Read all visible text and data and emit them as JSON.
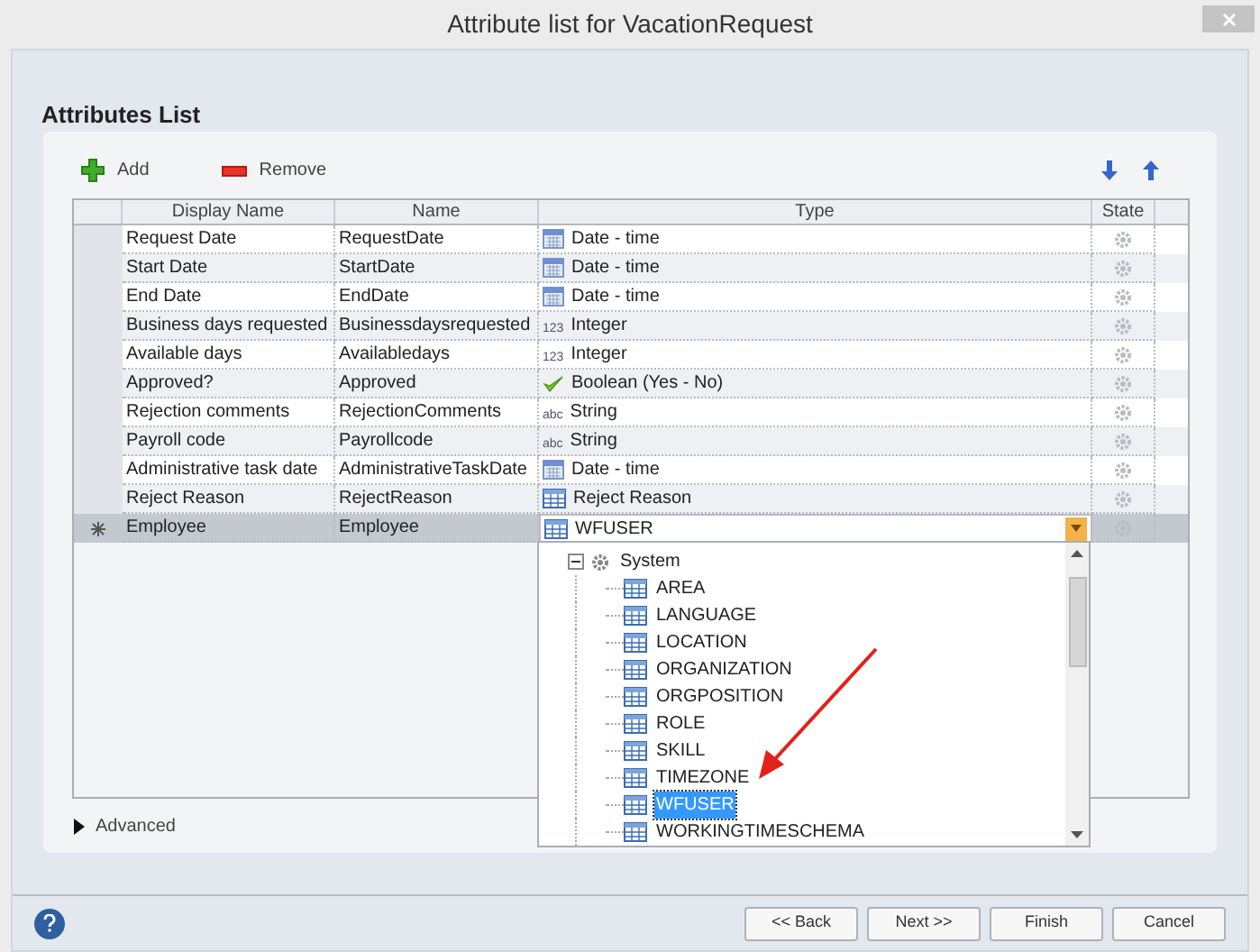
{
  "window": {
    "title": "Attribute list for VacationRequest"
  },
  "heading": "Attributes List",
  "toolbar": {
    "add": "Add",
    "remove": "Remove"
  },
  "table": {
    "columns": [
      "Display Name",
      "Name",
      "Type",
      "State"
    ],
    "rows": [
      {
        "display_name": "Request Date",
        "name": "RequestDate",
        "type": "Date - time",
        "kind": "datetime",
        "selected": false
      },
      {
        "display_name": "Start Date",
        "name": "StartDate",
        "type": "Date - time",
        "kind": "datetime",
        "selected": false
      },
      {
        "display_name": "End Date",
        "name": "EndDate",
        "type": "Date - time",
        "kind": "datetime",
        "selected": false
      },
      {
        "display_name": "Business days requested",
        "name": "Businessdaysrequested",
        "type": "Integer",
        "kind": "integer",
        "icon_text": "123",
        "selected": false
      },
      {
        "display_name": "Available days",
        "name": "Availabledays",
        "type": "Integer",
        "kind": "integer",
        "icon_text": "123",
        "selected": false
      },
      {
        "display_name": "Approved?",
        "name": "Approved",
        "type": "Boolean (Yes - No)",
        "kind": "boolean",
        "selected": false
      },
      {
        "display_name": "Rejection comments",
        "name": "RejectionComments",
        "type": "String",
        "kind": "string",
        "icon_text": "abc",
        "selected": false
      },
      {
        "display_name": "Payroll code",
        "name": "Payrollcode",
        "type": "String",
        "kind": "string",
        "icon_text": "abc",
        "selected": false
      },
      {
        "display_name": "Administrative task date",
        "name": "AdministrativeTaskDate",
        "type": "Date - time",
        "kind": "datetime",
        "selected": false
      },
      {
        "display_name": "Reject Reason",
        "name": "RejectReason",
        "type": "Reject Reason",
        "kind": "entity",
        "selected": false
      },
      {
        "display_name": "Employee",
        "name": "Employee",
        "type": "WFUSER",
        "kind": "entity",
        "selected": true
      }
    ]
  },
  "dropdown": {
    "group": {
      "label": "System",
      "expanded": true,
      "children": [
        {
          "label": "AREA",
          "selected": false
        },
        {
          "label": "LANGUAGE",
          "selected": false
        },
        {
          "label": "LOCATION",
          "selected": false
        },
        {
          "label": "ORGANIZATION",
          "selected": false
        },
        {
          "label": "ORGPOSITION",
          "selected": false
        },
        {
          "label": "ROLE",
          "selected": false
        },
        {
          "label": "SKILL",
          "selected": false
        },
        {
          "label": "TIMEZONE",
          "selected": false
        },
        {
          "label": "WFUSER",
          "selected": true
        },
        {
          "label": "WORKINGTIMESCHEMA",
          "selected": false
        }
      ]
    }
  },
  "advanced": {
    "label": "Advanced",
    "expanded": false
  },
  "buttons": [
    "<< Back",
    "Next >>",
    "Finish",
    "Cancel"
  ]
}
